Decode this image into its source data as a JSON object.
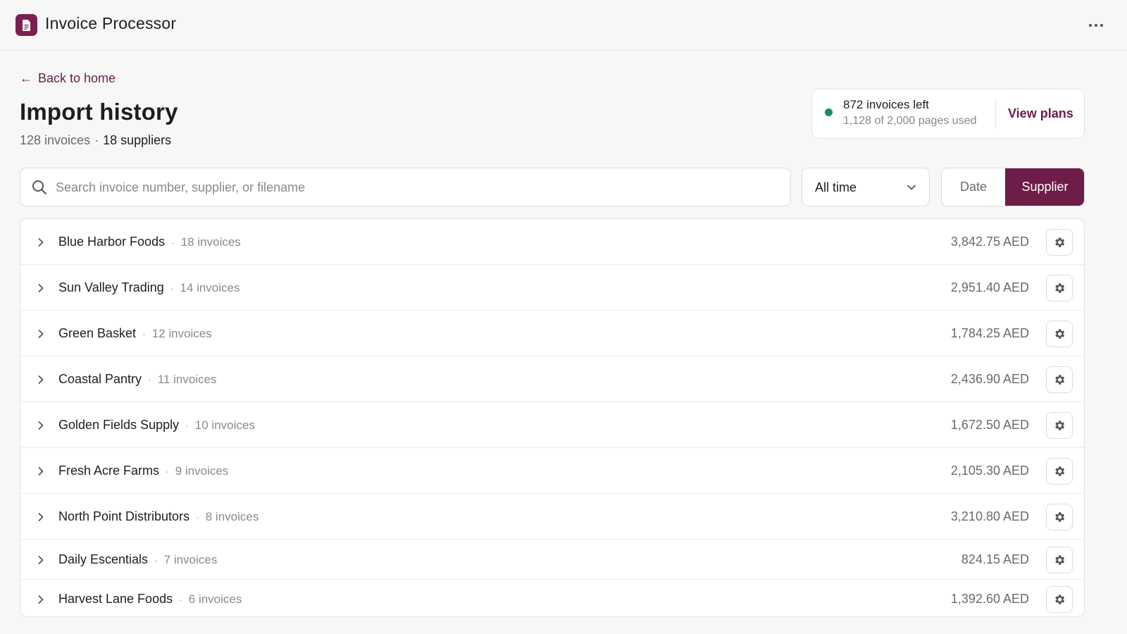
{
  "app": {
    "title": "Invoice Processor"
  },
  "nav": {
    "back_label": "Back to home"
  },
  "page": {
    "title": "Import history",
    "invoice_count": "128 invoices",
    "separator": "·",
    "supplier_count": "18 suppliers"
  },
  "usage": {
    "invoices_left": "872 invoices left",
    "pages_used": "1,128 of 2,000 pages used",
    "status_color": "#1a8c6a",
    "plans_label": "View plans"
  },
  "search": {
    "placeholder": "Search invoice number, supplier, or filename",
    "value": ""
  },
  "filter": {
    "selected": "All time"
  },
  "grouping": {
    "options": [
      "Date",
      "Supplier"
    ],
    "active": "Supplier"
  },
  "colors": {
    "accent": "#6e1c48",
    "brand": "#7a2050"
  },
  "suppliers": [
    {
      "name": "Blue Harbor Foods",
      "invoices": "18 invoices",
      "amount": "3,842.75 AED"
    },
    {
      "name": "Sun Valley Trading",
      "invoices": "14 invoices",
      "amount": "2,951.40 AED"
    },
    {
      "name": "Green Basket",
      "invoices": "12 invoices",
      "amount": "1,784.25 AED"
    },
    {
      "name": "Coastal Pantry",
      "invoices": "11 invoices",
      "amount": "2,436.90 AED"
    },
    {
      "name": "Golden Fields Supply",
      "invoices": "10 invoices",
      "amount": "1,672.50 AED"
    },
    {
      "name": "Fresh Acre Farms",
      "invoices": "9 invoices",
      "amount": "2,105.30 AED"
    },
    {
      "name": "North Point Distributors",
      "invoices": "8 invoices",
      "amount": "3,210.80 AED"
    },
    {
      "name": "Daily Escentials",
      "invoices": "7 invoices",
      "amount": "824.15 AED"
    },
    {
      "name": "Harvest Lane Foods",
      "invoices": "6 invoices",
      "amount": "1,392.60 AED"
    }
  ]
}
